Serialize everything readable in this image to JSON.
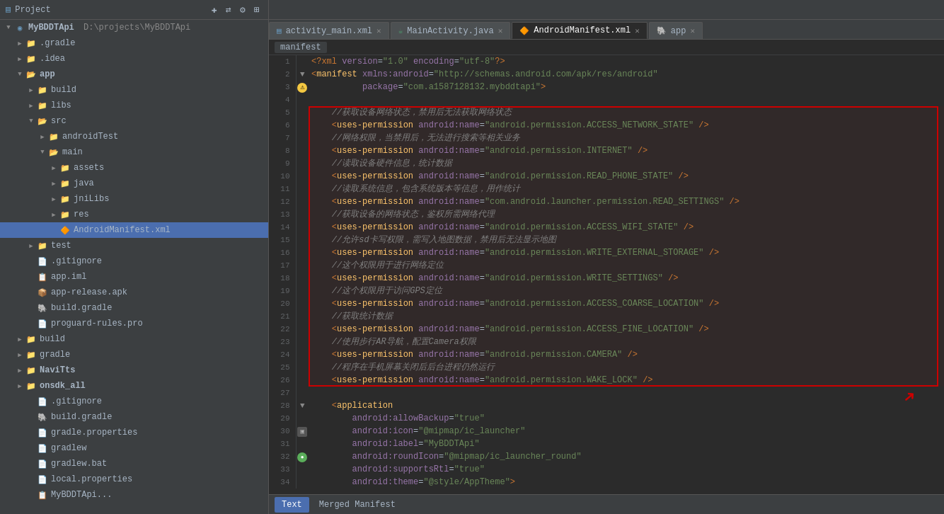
{
  "titlebar": {
    "project_label": "Project",
    "project_icon": "▤"
  },
  "sidebar": {
    "root": "MyBDDTApi",
    "root_path": "D:\\projects\\MyBDDTApi",
    "items": [
      {
        "id": "gradle",
        "label": ".gradle",
        "indent": 1,
        "type": "folder",
        "arrow": "▶"
      },
      {
        "id": "idea",
        "label": ".idea",
        "indent": 1,
        "type": "folder",
        "arrow": "▶"
      },
      {
        "id": "app",
        "label": "app",
        "indent": 1,
        "type": "folder-open",
        "arrow": "▼",
        "bold": true
      },
      {
        "id": "build-app",
        "label": "build",
        "indent": 2,
        "type": "folder",
        "arrow": "▶"
      },
      {
        "id": "libs",
        "label": "libs",
        "indent": 2,
        "type": "folder",
        "arrow": "▶"
      },
      {
        "id": "src",
        "label": "src",
        "indent": 2,
        "type": "folder-open",
        "arrow": "▼"
      },
      {
        "id": "androidTest",
        "label": "androidTest",
        "indent": 3,
        "type": "folder",
        "arrow": "▶"
      },
      {
        "id": "main",
        "label": "main",
        "indent": 3,
        "type": "folder-open",
        "arrow": "▼"
      },
      {
        "id": "assets",
        "label": "assets",
        "indent": 4,
        "type": "folder",
        "arrow": "▶"
      },
      {
        "id": "java",
        "label": "java",
        "indent": 4,
        "type": "folder",
        "arrow": "▶"
      },
      {
        "id": "jniLibs",
        "label": "jniLibs",
        "indent": 4,
        "type": "folder",
        "arrow": "▶"
      },
      {
        "id": "res",
        "label": "res",
        "indent": 4,
        "type": "folder",
        "arrow": "▶"
      },
      {
        "id": "androidmanifest",
        "label": "AndroidManifest.xml",
        "indent": 4,
        "type": "manifest",
        "arrow": "",
        "selected": true
      },
      {
        "id": "test",
        "label": "test",
        "indent": 2,
        "type": "folder",
        "arrow": "▶"
      },
      {
        "id": "gitignore-app",
        "label": ".gitignore",
        "indent": 2,
        "type": "text",
        "arrow": ""
      },
      {
        "id": "app-iml",
        "label": "app.iml",
        "indent": 2,
        "type": "iml",
        "arrow": ""
      },
      {
        "id": "app-release",
        "label": "app-release.apk",
        "indent": 2,
        "type": "apk",
        "arrow": ""
      },
      {
        "id": "build-gradle-app",
        "label": "build.gradle",
        "indent": 2,
        "type": "gradle",
        "arrow": ""
      },
      {
        "id": "proguard",
        "label": "proguard-rules.pro",
        "indent": 2,
        "type": "text",
        "arrow": ""
      },
      {
        "id": "build",
        "label": "build",
        "indent": 1,
        "type": "folder",
        "arrow": "▶"
      },
      {
        "id": "gradle",
        "label": "gradle",
        "indent": 1,
        "type": "folder",
        "arrow": "▶"
      },
      {
        "id": "NaviTts",
        "label": "NaviTts",
        "indent": 1,
        "type": "folder",
        "bold": true,
        "arrow": "▶"
      },
      {
        "id": "onsdk_all",
        "label": "onsdk_all",
        "indent": 1,
        "type": "folder",
        "bold": true,
        "arrow": "▶"
      },
      {
        "id": "gitignore-root",
        "label": ".gitignore",
        "indent": 2,
        "type": "text",
        "arrow": ""
      },
      {
        "id": "build-gradle-root",
        "label": "build.gradle",
        "indent": 2,
        "type": "gradle",
        "arrow": ""
      },
      {
        "id": "gradle-props",
        "label": "gradle.properties",
        "indent": 2,
        "type": "text",
        "arrow": ""
      },
      {
        "id": "gradlew",
        "label": "gradlew",
        "indent": 2,
        "type": "text",
        "arrow": ""
      },
      {
        "id": "gradlew-bat",
        "label": "gradlew.bat",
        "indent": 2,
        "type": "text",
        "arrow": ""
      },
      {
        "id": "local-props",
        "label": "local.properties",
        "indent": 2,
        "type": "text",
        "arrow": ""
      },
      {
        "id": "mybddtapi-iml",
        "label": "MyBDDTApi...",
        "indent": 2,
        "type": "iml",
        "arrow": ""
      }
    ]
  },
  "tabs": [
    {
      "id": "activity_main",
      "label": "activity_main.xml",
      "icon": "xml",
      "active": false
    },
    {
      "id": "mainactivity",
      "label": "MainActivity.java",
      "icon": "java",
      "active": false
    },
    {
      "id": "androidmanifest",
      "label": "AndroidManifest.xml",
      "icon": "manifest",
      "active": true
    },
    {
      "id": "app",
      "label": "app",
      "icon": "gradle",
      "active": false
    }
  ],
  "breadcrumb": "manifest",
  "code": {
    "lines": [
      {
        "num": 1,
        "content": "<?xml version=\"1.0\" encoding=\"utf-8\"?>",
        "gutter": ""
      },
      {
        "num": 2,
        "content": "<manifest xmlns:android=\"http://schemas.android.com/apk/res/android\"",
        "gutter": ""
      },
      {
        "num": 3,
        "content": "          package=\"com.a1587128132.mybddtapi\">",
        "gutter": "warning"
      },
      {
        "num": 4,
        "content": "",
        "gutter": ""
      },
      {
        "num": 5,
        "content": "    //获取设备网络状态，禁用后无法获取网络状态",
        "gutter": "",
        "comment": true
      },
      {
        "num": 6,
        "content": "    <uses-permission android:name=\"android.permission.ACCESS_NETWORK_STATE\" />",
        "gutter": ""
      },
      {
        "num": 7,
        "content": "    //网络权限，当禁用后，无法进行搜索等相关业务",
        "gutter": "",
        "comment": true
      },
      {
        "num": 8,
        "content": "    <uses-permission android:name=\"android.permission.INTERNET\" />",
        "gutter": ""
      },
      {
        "num": 9,
        "content": "    //读取设备硬件信息，统计数据",
        "gutter": "",
        "comment": true
      },
      {
        "num": 10,
        "content": "    <uses-permission android:name=\"android.permission.READ_PHONE_STATE\" />",
        "gutter": ""
      },
      {
        "num": 11,
        "content": "    //读取系统信息，包含系统版本等信息，用作统计",
        "gutter": "",
        "comment": true
      },
      {
        "num": 12,
        "content": "    <uses-permission android:name=\"com.android.launcher.permission.READ_SETTINGS\" />",
        "gutter": ""
      },
      {
        "num": 13,
        "content": "    //获取设备的网络状态，鉴权所需网络代理",
        "gutter": "",
        "comment": true
      },
      {
        "num": 14,
        "content": "    <uses-permission android:name=\"android.permission.ACCESS_WIFI_STATE\" />",
        "gutter": ""
      },
      {
        "num": 15,
        "content": "    //允许sd卡写权限，需写入地图数据，禁用后无法显示地图",
        "gutter": "",
        "comment": true
      },
      {
        "num": 16,
        "content": "    <uses-permission android:name=\"android.permission.WRITE_EXTERNAL_STORAGE\" />",
        "gutter": ""
      },
      {
        "num": 17,
        "content": "    //这个权限用于进行网络定位",
        "gutter": "",
        "comment": true
      },
      {
        "num": 18,
        "content": "    <uses-permission android:name=\"android.permission.WRITE_SETTINGS\" />",
        "gutter": ""
      },
      {
        "num": 19,
        "content": "    //这个权限用于访问GPS定位",
        "gutter": "",
        "comment": true
      },
      {
        "num": 20,
        "content": "    <uses-permission android:name=\"android.permission.ACCESS_COARSE_LOCATION\" />",
        "gutter": ""
      },
      {
        "num": 21,
        "content": "    //获取统计数据",
        "gutter": "",
        "comment": true
      },
      {
        "num": 22,
        "content": "    <uses-permission android:name=\"android.permission.ACCESS_FINE_LOCATION\" />",
        "gutter": ""
      },
      {
        "num": 23,
        "content": "    //使用步行AR导航，配置Camera权限",
        "gutter": "",
        "comment": true
      },
      {
        "num": 24,
        "content": "    <uses-permission android:name=\"android.permission.CAMERA\" />",
        "gutter": ""
      },
      {
        "num": 25,
        "content": "    //程序在手机屏幕关闭后后台进程仍然运行",
        "gutter": "",
        "comment": true
      },
      {
        "num": 26,
        "content": "    <uses-permission android:name=\"android.permission.WAKE_LOCK\" />",
        "gutter": ""
      },
      {
        "num": 27,
        "content": "",
        "gutter": ""
      },
      {
        "num": 28,
        "content": "    <application",
        "gutter": "fold"
      },
      {
        "num": 29,
        "content": "        android:allowBackup=\"true\"",
        "gutter": ""
      },
      {
        "num": 30,
        "content": "        android:icon=\"@mipmap/ic_launcher\"",
        "gutter": "icon1"
      },
      {
        "num": 31,
        "content": "        android:label=\"MyBDDTApi\"",
        "gutter": ""
      },
      {
        "num": 32,
        "content": "        android:roundIcon=\"@mipmap/ic_launcher_round\"",
        "gutter": "icon2"
      },
      {
        "num": 33,
        "content": "        android:supportsRtl=\"true\"",
        "gutter": ""
      },
      {
        "num": 34,
        "content": "        android:theme=\"@style/AppTheme\">",
        "gutter": ""
      }
    ]
  },
  "bottom_tabs": [
    {
      "id": "text",
      "label": "Text",
      "active": true
    },
    {
      "id": "merged",
      "label": "Merged Manifest",
      "active": false
    }
  ]
}
